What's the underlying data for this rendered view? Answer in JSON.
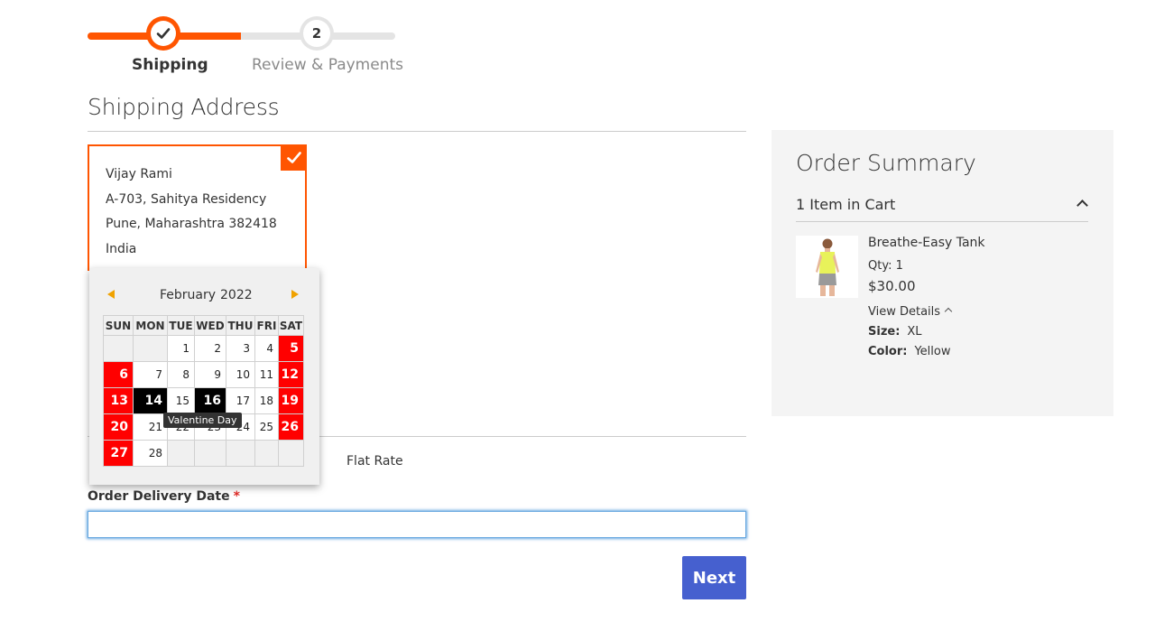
{
  "progress": {
    "steps": [
      {
        "label": "Shipping",
        "number": "1",
        "state": "complete"
      },
      {
        "label": "Review & Payments",
        "number": "2",
        "state": "pending"
      }
    ],
    "accent_color": "#ff5501"
  },
  "shipping": {
    "title": "Shipping Address",
    "address": {
      "name": "Vijay Rami",
      "street": "A-703, Sahitya Residency",
      "city_line": "Pune, Maharashtra 382418",
      "country": "India"
    }
  },
  "calendar": {
    "month": "February",
    "year": "2022",
    "weekdays": [
      "SUN",
      "MON",
      "TUE",
      "WED",
      "THU",
      "FRI",
      "SAT"
    ],
    "weeks": [
      [
        "",
        "",
        "1",
        "2",
        "3",
        "4",
        "5"
      ],
      [
        "6",
        "7",
        "8",
        "9",
        "10",
        "11",
        "12"
      ],
      [
        "13",
        "14",
        "15",
        "16",
        "17",
        "18",
        "19"
      ],
      [
        "20",
        "21",
        "22",
        "23",
        "24",
        "25",
        "26"
      ],
      [
        "27",
        "28",
        "",
        "",
        "",
        "",
        ""
      ]
    ],
    "highlighted_days": [
      "14",
      "16"
    ],
    "tooltip": "Valentine Day",
    "weekend_color": "#ff0000"
  },
  "shipping_method": {
    "label": "Flat Rate"
  },
  "delivery": {
    "label": "Order Delivery Date",
    "required_mark": "*",
    "value": ""
  },
  "actions": {
    "next_label": "Next",
    "button_color": "#4660cf"
  },
  "summary": {
    "title": "Order Summary",
    "items_count": "1 Item in Cart",
    "product": {
      "name": "Breathe-Easy Tank",
      "qty": "Qty: 1",
      "price": "$30.00",
      "view_details": "View Details",
      "options": [
        {
          "label": "Size:",
          "value": "XL"
        },
        {
          "label": "Color:",
          "value": "Yellow"
        }
      ]
    }
  }
}
